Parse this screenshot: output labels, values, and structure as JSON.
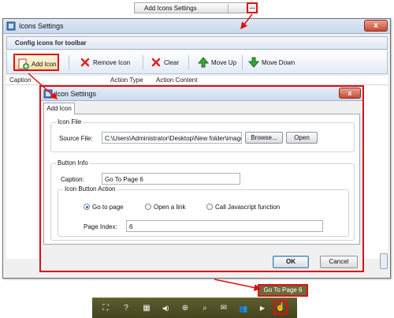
{
  "top_field": {
    "label": "Add Icons Settings",
    "more_button": "..."
  },
  "main_window": {
    "title": "Icons Settings",
    "close": "x",
    "section_title": "Config icons for toolbar",
    "toolbar": [
      {
        "label": "Add Icon",
        "icon": "add-icon-icon"
      },
      {
        "label": "Remove Icon",
        "icon": "remove-x-icon"
      },
      {
        "label": "Clear",
        "icon": "clear-x-icon"
      },
      {
        "label": "Move Up",
        "icon": "arrow-up-icon"
      },
      {
        "label": "Move Down",
        "icon": "arrow-down-icon"
      }
    ],
    "columns": [
      "Caption",
      "Action Type",
      "Action Content"
    ]
  },
  "dialog": {
    "title": "Icon Settings",
    "close": "x",
    "tab": "Add Icon",
    "icon_file": {
      "group_title": "Icon File",
      "source_label": "Source File:",
      "source_value": "C:\\Users\\Administrator\\Desktop\\New folder\\images\\",
      "browse": "Browse...",
      "open": "Open"
    },
    "button_info": {
      "group_title": "Button Info",
      "caption_label": "Caption:",
      "caption_value": "Go To Page 6",
      "action_group_title": "Icon Button Action",
      "radios": [
        {
          "label": "Go to page",
          "selected": true
        },
        {
          "label": "Open a link",
          "selected": false
        },
        {
          "label": "Call Javascript function",
          "selected": false
        }
      ],
      "page_index_label": "Page Index:",
      "page_index_value": "6"
    },
    "ok": "OK",
    "cancel": "Cancel"
  },
  "tooltip": "Go To Page 6",
  "viewer_bar": {
    "buttons": [
      {
        "icon": "fit-screen-icon",
        "glyph": "⛶"
      },
      {
        "icon": "help-icon",
        "glyph": "?"
      },
      {
        "icon": "thumbnails-icon",
        "glyph": "▦"
      },
      {
        "icon": "sound-icon",
        "glyph": "◀)"
      },
      {
        "icon": "zoom-in-icon",
        "glyph": "⊕"
      },
      {
        "icon": "search-icon",
        "glyph": "⌕"
      },
      {
        "icon": "email-icon",
        "glyph": "✉"
      },
      {
        "icon": "social-share-icon",
        "glyph": "👥"
      },
      {
        "icon": "play-icon",
        "glyph": "▶"
      },
      {
        "icon": "hand-cursor-icon",
        "glyph": "☝"
      }
    ]
  },
  "colors": {
    "highlight": "#dd1111",
    "title_bar": "#cddcf0",
    "viewer_bar": "#4f4f25"
  }
}
